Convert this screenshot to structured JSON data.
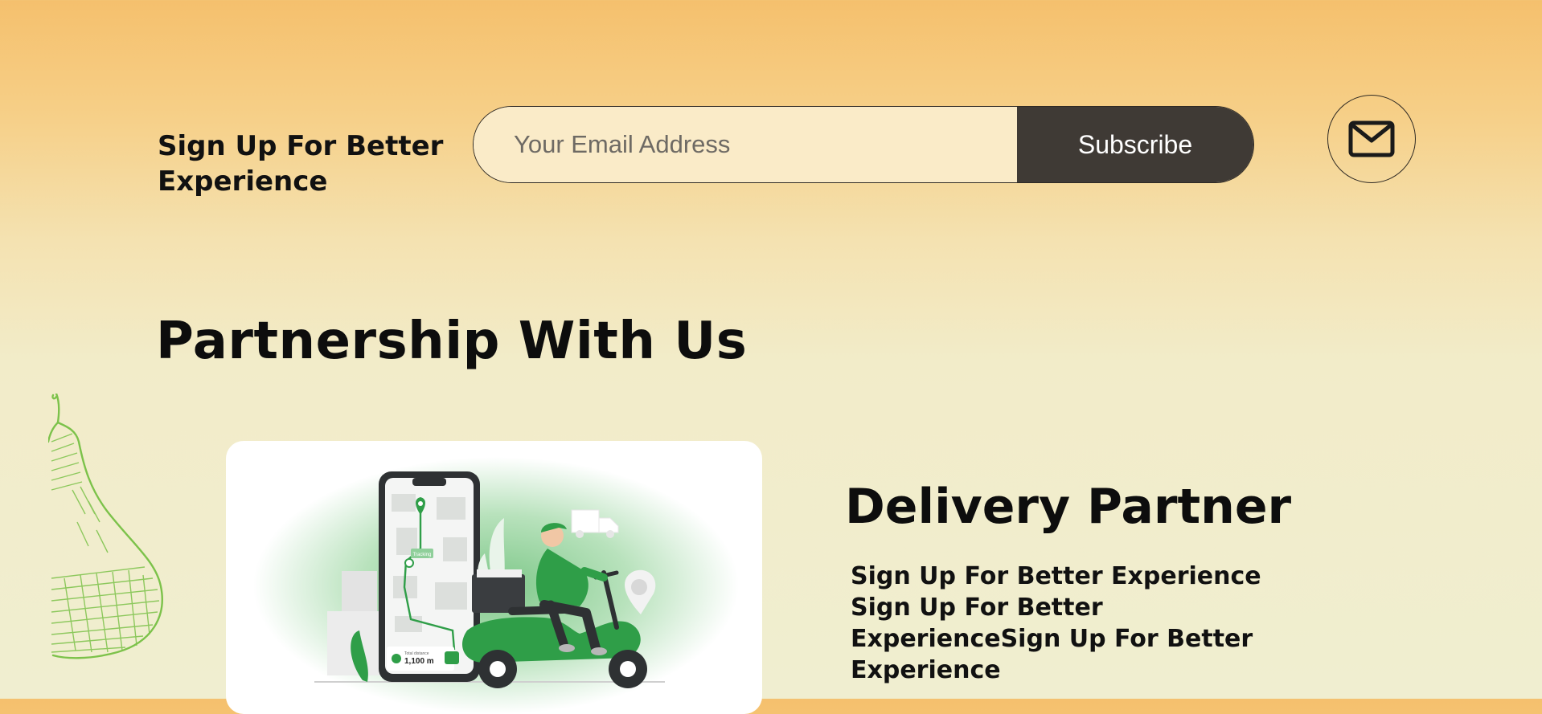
{
  "newsletter": {
    "title": "Sign Up For Better Experience",
    "email_placeholder": "Your Email Address",
    "subscribe_label": "Subscribe",
    "mail_icon": "mail-icon"
  },
  "partnership": {
    "title": "Partnership With Us",
    "card": {
      "illustration": "delivery-scooter-illustration",
      "map_label": "Tracking",
      "distance_caption": "Total distance",
      "distance_value": "1,100 m"
    },
    "partner_title": "Delivery Partner",
    "partner_description": "Sign Up For Better Experience Sign Up For Better ExperienceSign Up For Better Experience"
  },
  "decor": {
    "pear_icon": "pear-sketch-icon"
  },
  "colors": {
    "gradient_top": "#f5c06d",
    "gradient_bottom": "#f0eed0",
    "input_bg": "#faebc8",
    "button_bg": "#3f3a35",
    "accent_green": "#2f9e48",
    "pear_green": "#7cc24a"
  }
}
